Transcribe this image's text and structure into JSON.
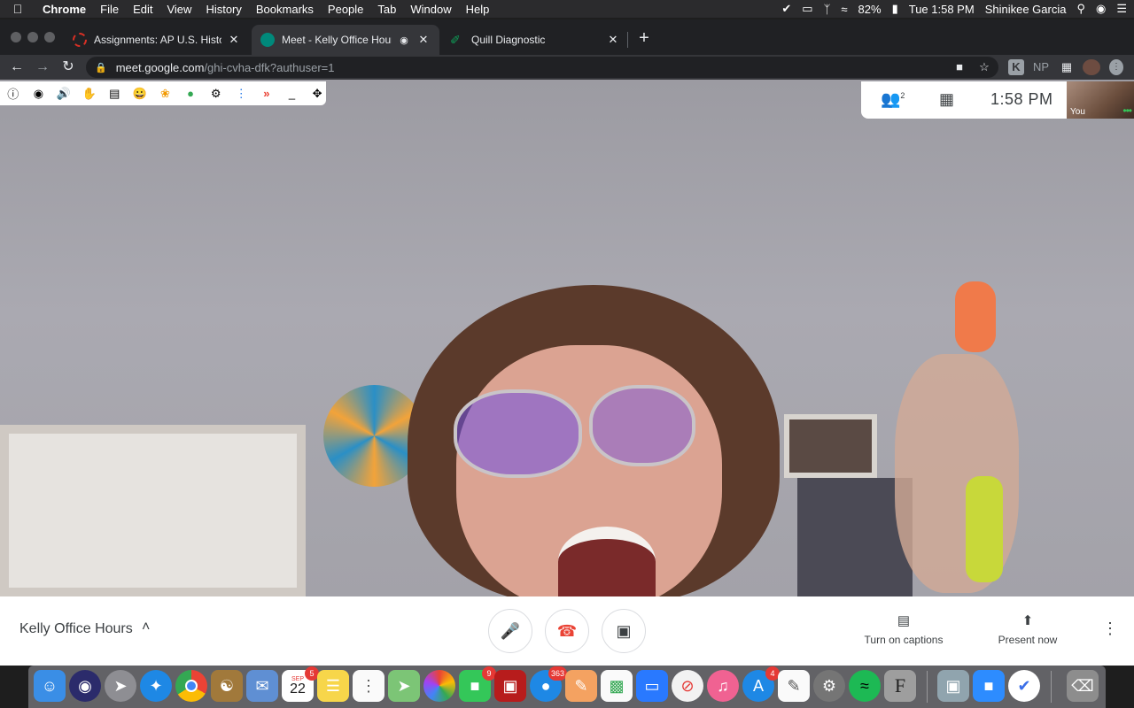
{
  "menubar": {
    "app": "Chrome",
    "items": [
      "File",
      "Edit",
      "View",
      "History",
      "Bookmarks",
      "People",
      "Tab",
      "Window",
      "Help"
    ],
    "battery": "82%",
    "datetime": "Tue 1:58 PM",
    "user": "Shinikee Garcia"
  },
  "tabs": [
    {
      "title": "Assignments: AP U.S. History -",
      "favicon_color": "#d93025"
    },
    {
      "title": "Meet - Kelly Office Hours",
      "favicon_color": "#00897b"
    },
    {
      "title": "Quill Diagnostic",
      "favicon_color": "#0f9d58"
    }
  ],
  "address": {
    "host": "meet.google.com",
    "path": "/ghi-cvha-dfk?authuser=1"
  },
  "toolbar_ext": {
    "np_label": "NP"
  },
  "meet": {
    "participants_count": "2",
    "clock": "1:58 PM",
    "self_label": "You",
    "meeting_title": "Kelly Office Hours",
    "captions_label": "Turn on captions",
    "present_label": "Present now"
  },
  "dock": {
    "calendar_month": "SEP",
    "calendar_day": "22",
    "badges": {
      "calendar": "5",
      "facetime": "9",
      "messages": "363",
      "appstore": "4"
    }
  },
  "colors": {
    "accent_red": "#ea4335",
    "meet_teal": "#00897b"
  }
}
